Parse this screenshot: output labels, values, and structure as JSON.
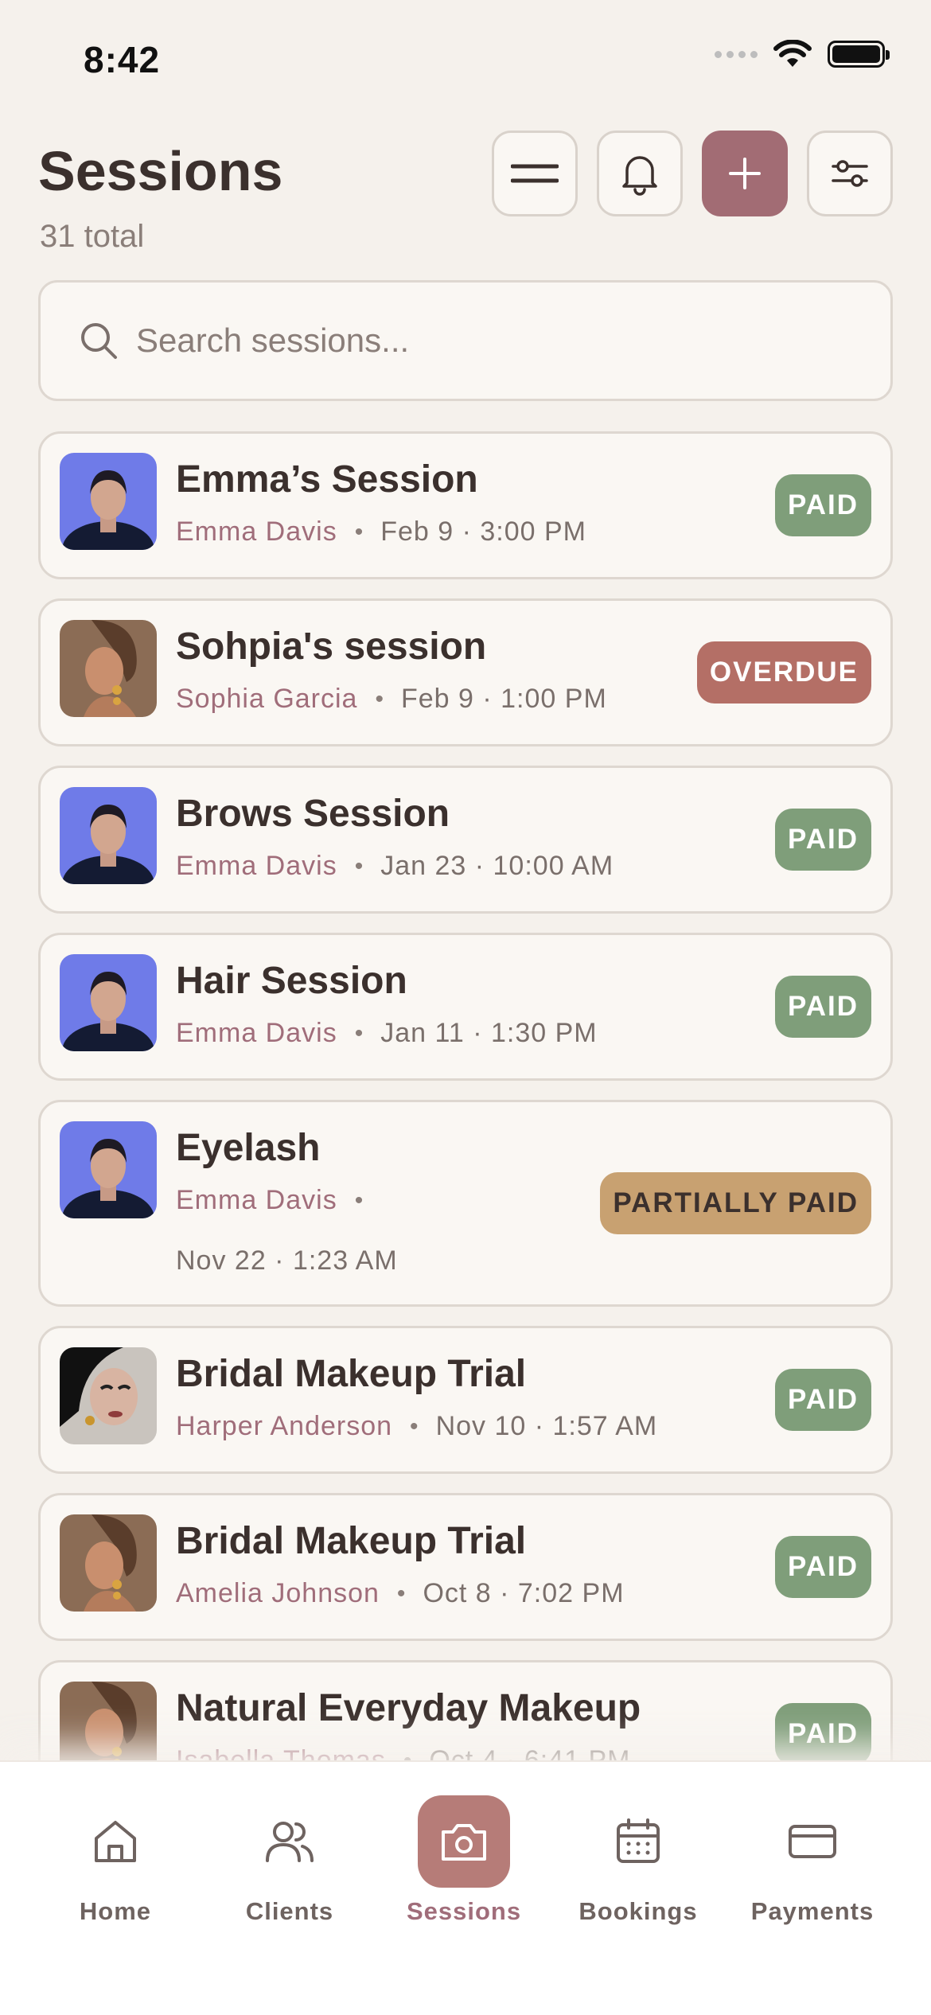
{
  "status_bar": {
    "time": "8:42"
  },
  "header": {
    "title": "Sessions",
    "subtitle": "31 total",
    "actions": [
      {
        "icon": "menu-icon"
      },
      {
        "icon": "bell-icon"
      },
      {
        "icon": "plus-icon"
      },
      {
        "icon": "sliders-icon"
      }
    ]
  },
  "search": {
    "placeholder": "Search sessions..."
  },
  "sessions": [
    {
      "title": "Emma’s Session",
      "client": "Emma Davis",
      "when": "Feb 9 · 3:00 PM",
      "status": "PAID"
    },
    {
      "title": "Sohpia's session",
      "client": "Sophia Garcia",
      "when": "Feb 9 · 1:00 PM",
      "status": "OVERDUE"
    },
    {
      "title": "Brows Session",
      "client": "Emma Davis",
      "when": "Jan 23 · 10:00 AM",
      "status": "PAID"
    },
    {
      "title": "Hair Session",
      "client": "Emma Davis",
      "when": "Jan 11 · 1:30 PM",
      "status": "PAID"
    },
    {
      "title": "Eyelash",
      "client": "Emma Davis",
      "when": "Nov 22 · 1:23 AM",
      "status": "PARTIALLY PAID"
    },
    {
      "title": "Bridal Makeup Trial",
      "client": "Harper Anderson",
      "when": "Nov 10 · 1:57 AM",
      "status": "PAID"
    },
    {
      "title": "Bridal Makeup Trial",
      "client": "Amelia Johnson",
      "when": "Oct 8 · 7:02 PM",
      "status": "PAID"
    },
    {
      "title": "Natural Everyday Makeup",
      "client": "Isabella Thomas",
      "when": "Oct 4 · 6:41 PM",
      "status": "PAID"
    }
  ],
  "tabs": [
    {
      "label": "Home",
      "icon": "home-icon"
    },
    {
      "label": "Clients",
      "icon": "users-icon"
    },
    {
      "label": "Sessions",
      "icon": "camera-icon",
      "active": true
    },
    {
      "label": "Bookings",
      "icon": "calendar-icon"
    },
    {
      "label": "Payments",
      "icon": "credit-card-icon"
    }
  ],
  "colors": {
    "background": "#F5F1EC",
    "accent": "#A26C74",
    "paid": "#7F9E7A",
    "overdue": "#B46F66",
    "partial": "#C8A171"
  }
}
